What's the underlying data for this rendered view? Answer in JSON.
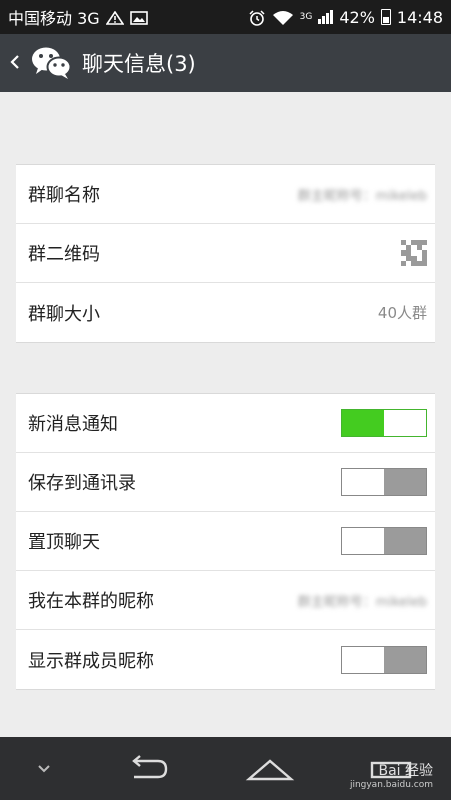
{
  "status_bar": {
    "carrier": "中国移动 3G",
    "network_badge": "3G",
    "battery": "42%",
    "time": "14:48"
  },
  "header": {
    "title": "聊天信息(3)",
    "back_icon": "chevron-left-icon",
    "logo_icon": "wechat-logo-icon"
  },
  "group_info": {
    "name_label": "群聊名称",
    "name_value": "群主昵称号：mikeleb",
    "qr_label": "群二维码",
    "size_label": "群聊大小",
    "size_value": "40人群"
  },
  "settings": {
    "notify_label": "新消息通知",
    "notify_on": true,
    "save_contacts_label": "保存到通讯录",
    "save_contacts_on": false,
    "pin_label": "置顶聊天",
    "pin_on": false,
    "nickname_label": "我在本群的昵称",
    "nickname_value": "群主昵称号：mikeleb",
    "show_nicknames_label": "显示群成员昵称",
    "show_nicknames_on": false
  },
  "nav_bar": {
    "watermark_brand": "Bai 经验",
    "watermark_url": "jingyan.baidu.com"
  },
  "colors": {
    "toggle_on": "#44cc20",
    "toggle_off": "#9b9b9b",
    "action_bar": "#3b3f44",
    "status_bar": "#1c1c1c"
  }
}
